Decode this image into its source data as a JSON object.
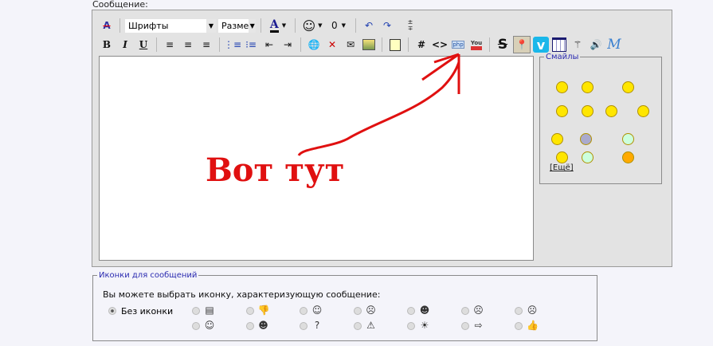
{
  "form": {
    "message_label": "Сообщение:"
  },
  "toolbar": {
    "font_select": "Шрифты",
    "size_select": "Разме",
    "font_color_letter": "A",
    "bold": "B",
    "italic": "I",
    "underline": "U",
    "hash": "#",
    "code": "<>",
    "php": "php",
    "youtube": "You",
    "strike": "S",
    "vimeo": "v",
    "mathml": "M"
  },
  "smilies": {
    "legend": "Смайлы",
    "more_link": "[Ещё]"
  },
  "message_icons": {
    "legend": "Иконки для сообщений",
    "hint": "Вы можете выбрать иконку, характеризующую сообщение:",
    "no_icon_label": "Без иконки",
    "icons": [
      "page",
      "thumbs-down",
      "smile",
      "shocked",
      "grin",
      "sad",
      "angry",
      "happy",
      "cool",
      "question",
      "warning",
      "lightbulb",
      "arrow",
      "thumbs-up"
    ]
  },
  "annotation": {
    "text": "Вот тут",
    "color": "#e01010"
  }
}
